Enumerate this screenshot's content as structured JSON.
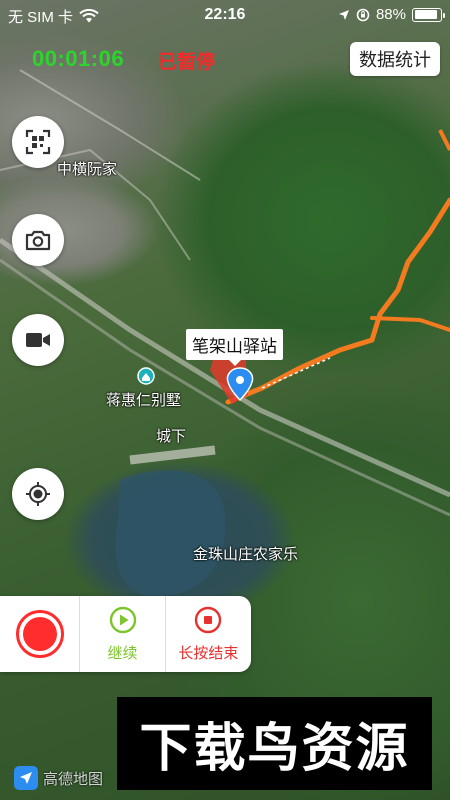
{
  "status_bar": {
    "carrier": "无 SIM 卡",
    "time": "22:16",
    "battery_percent": "88%",
    "battery_level": 0.88
  },
  "recording": {
    "elapsed": "00:01:06",
    "state": "已暂停"
  },
  "header": {
    "stats_button": "数据统计"
  },
  "side_buttons": [
    {
      "icon": "scan-icon"
    },
    {
      "icon": "camera-icon"
    },
    {
      "icon": "video-icon"
    },
    {
      "icon": "locate-icon"
    }
  ],
  "map": {
    "labels": {
      "zhongheng": "中横阮家",
      "jianghui": "蒋惠仁别墅",
      "chengxia": "城下",
      "jinzhu": "金珠山庄农家乐"
    },
    "station": "笔架山驿站",
    "logo": "高德地图",
    "route_color": "#f47a1f"
  },
  "controls": {
    "continue_label": "继续",
    "end_label": "长按结束"
  },
  "watermark": "下载鸟资源",
  "colors": {
    "timer": "#2bd62b",
    "paused": "#f22a2a",
    "record": "#ff2d2d",
    "continue": "#7cc52b",
    "end": "#e8312f"
  }
}
